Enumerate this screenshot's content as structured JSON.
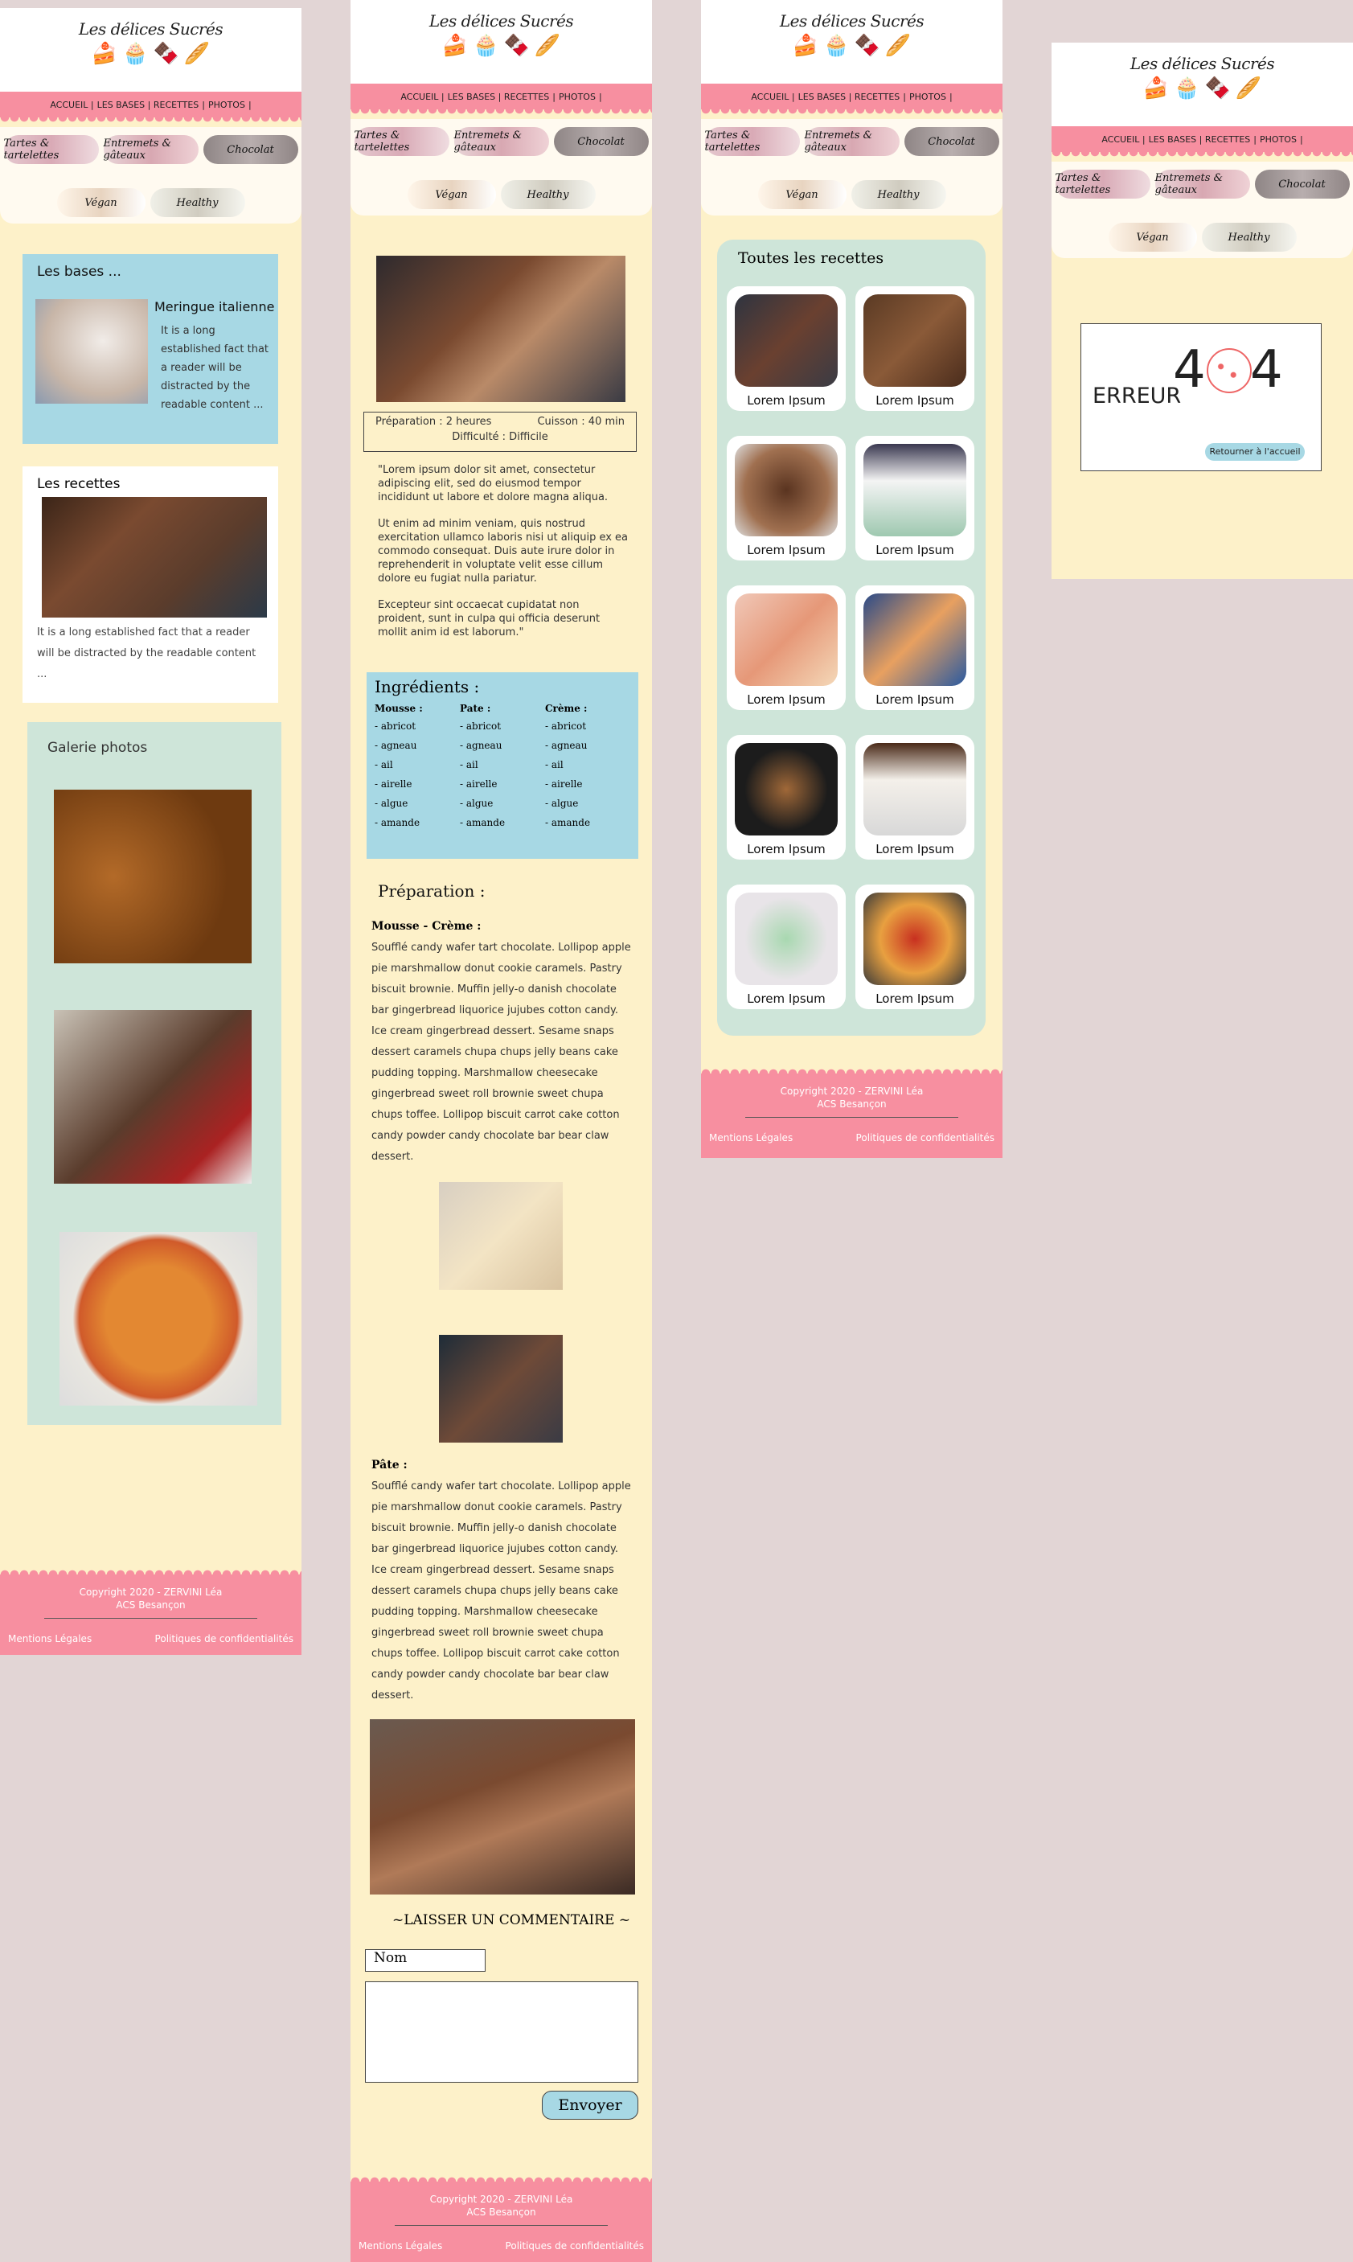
{
  "site": {
    "title": "Les délices Sucrés",
    "icons": [
      "🍰",
      "🧁",
      "🍫",
      "🥖"
    ],
    "nav": [
      "ACCUEIL |",
      "LES BASES | RECETTES",
      "|",
      "PHOTOS",
      "|"
    ],
    "categories": [
      "Tartes & tartelettes",
      "Entremets & gâteaux",
      "Chocolat",
      "Végan",
      "Healthy"
    ],
    "footer": {
      "copy1": "Copyright 2020 - ZERVINI Léa",
      "copy2": "ACS Besançon",
      "legal": "Mentions Légales",
      "privacy": "Politiques de confidentialités"
    }
  },
  "home": {
    "bases_title": "Les bases ...",
    "bases_item": "Meringue italienne",
    "bases_desc": "It is a long established fact that a reader will be distracted by the readable content ...",
    "recettes_title": "Les recettes",
    "recettes_desc": "It is a long established fact that a reader will be distracted by the readable content ...",
    "galerie_title": "Galerie photos"
  },
  "recipe": {
    "prep": "Préparation : 2 heures",
    "cuisson": "Cuisson : 40 min",
    "difficulty": "Difficulté : Difficile",
    "lorem1": "\"Lorem ipsum dolor sit amet, consectetur adipiscing elit, sed do eiusmod tempor incididunt ut labore et dolore magna aliqua.",
    "lorem2": "Ut enim ad minim veniam, quis nostrud exercitation ullamco laboris nisi ut aliquip ex ea commodo consequat. Duis aute irure dolor in reprehenderit in voluptate velit esse cillum dolore eu fugiat nulla pariatur.",
    "lorem3": " Excepteur sint occaecat cupidatat non proident, sunt in culpa qui officia deserunt mollit anim id est laborum.\"",
    "ingredients_title": "Ingrédients :",
    "ingr_cols": [
      {
        "title": "Mousse :",
        "items": [
          "-    abricot",
          "-    agneau",
          "-    ail",
          "-    airelle",
          "-    algue",
          "-    amande"
        ]
      },
      {
        "title": "Pate :",
        "items": [
          "-    abricot",
          "-    agneau",
          "-    ail",
          "-    airelle",
          "-    algue",
          "-    amande"
        ]
      },
      {
        "title": "Crème :",
        "items": [
          "-    abricot",
          "-    agneau",
          "-    ail",
          "-    airelle",
          "-    algue",
          "-    amande"
        ]
      }
    ],
    "preparation_title": "Préparation :",
    "mousse_title": "Mousse - Crème :",
    "mousse_text": "Soufflé candy wafer tart chocolate. Lollipop apple pie marshmallow donut cookie caramels. Pastry biscuit brownie. Muffin jelly-o danish chocolate bar gingerbread liquorice jujubes cotton candy. Ice cream gingerbread dessert. Sesame snaps dessert caramels chupa chups jelly beans cake pudding topping. Marshmallow cheesecake gingerbread sweet roll brownie sweet chupa chups toffee. Lollipop biscuit carrot cake cotton candy powder candy chocolate bar bear claw dessert.",
    "pate_title": "Pâte :",
    "pate_text": "Soufflé candy wafer tart chocolate. Lollipop apple pie marshmallow donut cookie caramels. Pastry biscuit brownie. Muffin jelly-o danish chocolate bar gingerbread liquorice jujubes cotton candy. Ice cream gingerbread dessert. Sesame snaps dessert caramels chupa chups jelly beans cake pudding topping. Marshmallow cheesecake gingerbread sweet roll brownie sweet chupa chups toffee. Lollipop biscuit carrot cake cotton candy powder candy chocolate bar bear claw dessert.",
    "comment_title": "~LAISSER UN COMMENTAIRE ~",
    "name_placeholder": "Nom",
    "send": "Envoyer"
  },
  "list": {
    "title": "Toutes les recettes",
    "card_label": "Lorem Ipsum"
  },
  "error": {
    "erreur": "ERREUR",
    "digit1": "4",
    "digit2": "4",
    "back": "Retourner à l'accueil"
  }
}
